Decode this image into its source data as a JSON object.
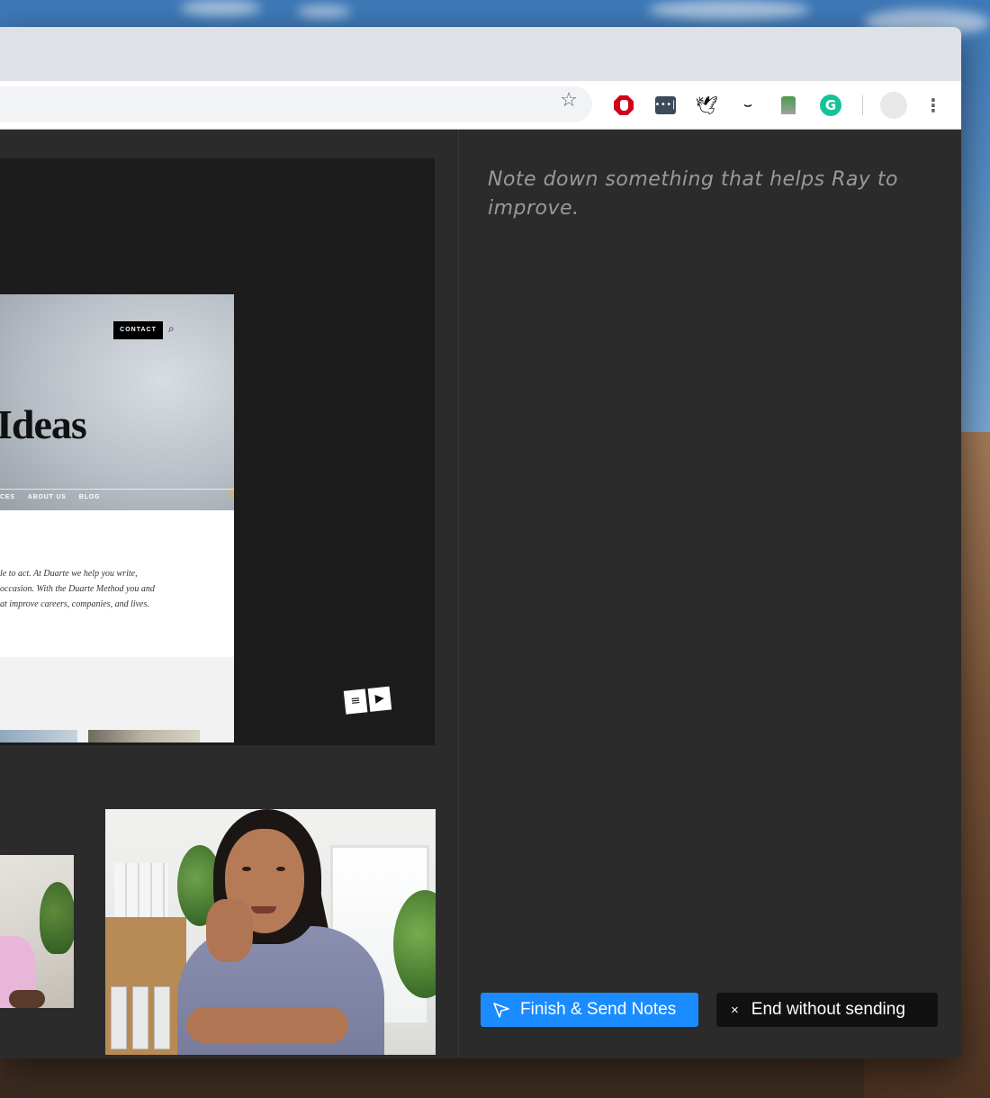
{
  "browser": {
    "extensions": [
      {
        "name": "adblock-icon"
      },
      {
        "name": "lastpass-icon",
        "glyph": "•••|"
      },
      {
        "name": "bird-extension-icon",
        "glyph": "🕊"
      },
      {
        "name": "eye-closed-icon",
        "glyph": "⌣"
      },
      {
        "name": "pin-extension-icon"
      },
      {
        "name": "grammarly-icon",
        "glyph": "G"
      }
    ],
    "menu_glyph": "⋮",
    "star_glyph": "☆"
  },
  "shared_site": {
    "contact_label": "CONTACT",
    "search_glyph": "⌕",
    "hero_title": "Ideas",
    "nav": [
      "CES",
      "ABOUT US",
      "BLOG"
    ],
    "body_lines": [
      "le to act. At Duarte we help you write,",
      " occasion. With the Duarte Method you and",
      "at improve careers, companies, and lives."
    ],
    "player_icons": [
      "≡",
      "▶"
    ]
  },
  "notes": {
    "placeholder": "Note down something that helps Ray to improve."
  },
  "actions": {
    "send_label": "Finish & Send Notes",
    "end_label": "End without sending",
    "end_glyph": "×"
  },
  "colors": {
    "accent": "#1a8cff",
    "panel": "#2b2b2b",
    "end_button": "#111111"
  }
}
